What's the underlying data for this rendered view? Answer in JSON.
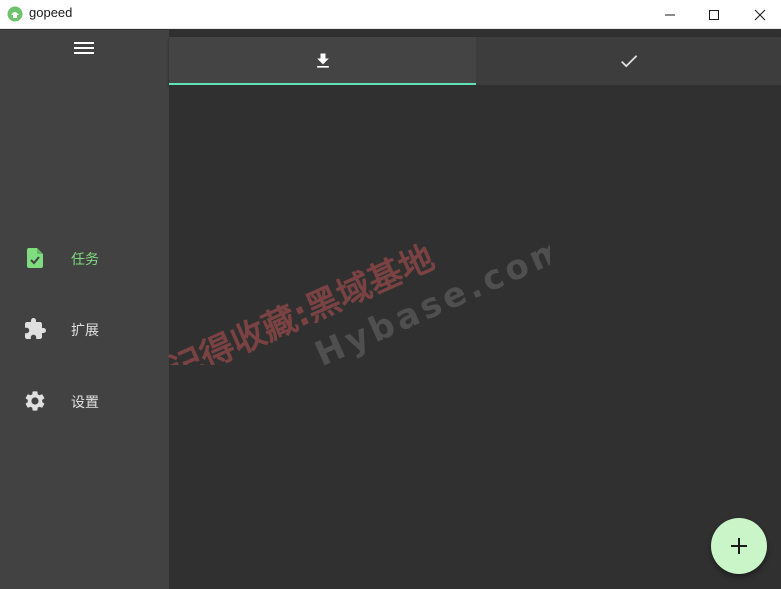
{
  "window": {
    "title": "gopeed",
    "controls": [
      "minimize",
      "maximize",
      "close"
    ]
  },
  "colors": {
    "accent": "#7fdc7f",
    "tab_indicator": "#5fe3b4",
    "fab": "#c9f5c9",
    "sidebar": "#424242",
    "content": "#303030"
  },
  "sidebar": {
    "menu_icon": "menu-icon",
    "items": [
      {
        "label": "任务",
        "icon": "task-icon",
        "active": true
      },
      {
        "label": "扩展",
        "icon": "extension-icon",
        "active": false
      },
      {
        "label": "设置",
        "icon": "settings-icon",
        "active": false
      }
    ]
  },
  "tabs": [
    {
      "icon": "download-icon",
      "active": true
    },
    {
      "icon": "check-icon",
      "active": false
    }
  ],
  "watermark": {
    "line1": "记得收藏:黑域基地",
    "line2": "Hybase.com"
  },
  "fab": {
    "icon": "plus-icon"
  }
}
